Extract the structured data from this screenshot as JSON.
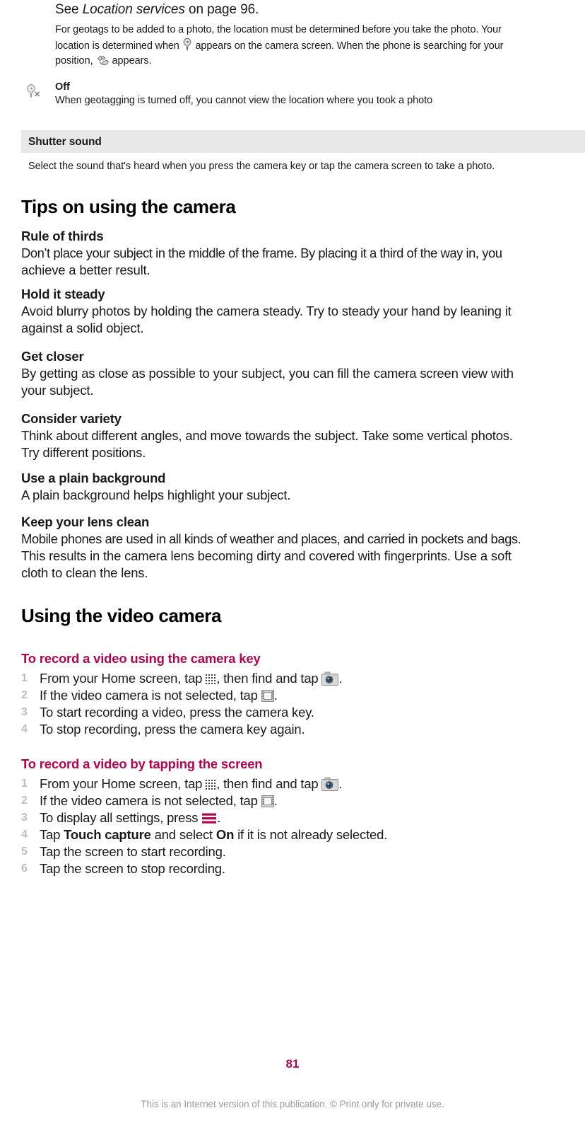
{
  "document": {
    "page_number": "81",
    "footnote": "This is an Internet version of this publication. © Print only for private use.",
    "accent_color": "#b3054f",
    "band_color": "#e8e8e8",
    "step_number_color": "#bdbdbd"
  },
  "intro": {
    "see_prefix": "See ",
    "see_link": "Location services",
    "see_suffix": " on page 96.",
    "geotag_paragraph": {
      "line1": "For geotags to be added to a photo, the location must be determined before you take the photo. Your",
      "line2_a": "location is determined when",
      "line2_icon": "location-pin-icon",
      "line2_b": "appears on the camera screen. When the phone is searching for your",
      "line3_a": "position,",
      "line3_icon": "satellite-searching-icon",
      "line3_b": "appears."
    }
  },
  "off_note": {
    "icon": "location-off-icon",
    "title": "Off",
    "body": "When geotagging is turned off, you cannot view the location where you took a photo"
  },
  "shutter_sound": {
    "label": "Shutter sound",
    "description": "Select the sound that's heard when you press the camera key or tap the camera screen to take a photo."
  },
  "tips_section": {
    "heading": "Tips on using the camera",
    "tips": [
      {
        "title": "Rule of thirds",
        "lines": [
          "Don’t place your subject in the middle of the frame. By placing it a third of the way in, you",
          "achieve a better result."
        ]
      },
      {
        "title": "Hold it steady",
        "lines": [
          "Avoid blurry photos by holding the camera steady. Try to steady your hand by leaning it",
          "against a solid object."
        ]
      },
      {
        "title": "Get closer",
        "lines": [
          "By getting as close as possible to your subject, you can fill the camera screen view with",
          "your subject."
        ]
      },
      {
        "title": "Consider variety",
        "lines": [
          "Think about different angles, and move towards the subject. Take some vertical photos.",
          "Try different positions."
        ]
      },
      {
        "title": "Use a plain background",
        "lines": [
          "A plain background helps highlight your subject."
        ]
      },
      {
        "title": "Keep your lens clean",
        "lines": [
          "Mobile phones are used in all kinds of weather and places, and carried in pockets and bags.",
          "This results in the camera lens becoming dirty and covered with fingerprints. Use a soft",
          "cloth to clean the lens."
        ]
      }
    ]
  },
  "video_section": {
    "heading": "Using the video camera",
    "procedures": [
      {
        "title": "To record a video using the camera key",
        "steps": [
          {
            "num": "1",
            "type": "icons_drawer_camera",
            "text_a": "From your Home screen, tap",
            "icon_a": "app-drawer-icon",
            "text_b": ", then find and tap",
            "icon_b": "camera-icon",
            "text_c": "."
          },
          {
            "num": "2",
            "type": "icon_film",
            "text_a": "If the video camera is not selected, tap",
            "icon_a": "video-camera-icon",
            "text_c": "."
          },
          {
            "num": "3",
            "type": "plain",
            "text_a": "To start recording a video, press the camera key."
          },
          {
            "num": "4",
            "type": "plain",
            "text_a": "To stop recording, press the camera key again."
          }
        ]
      },
      {
        "title": "To record a video by tapping the screen",
        "steps": [
          {
            "num": "1",
            "type": "icons_drawer_camera",
            "text_a": "From your Home screen, tap",
            "icon_a": "app-drawer-icon",
            "text_b": ", then find and tap",
            "icon_b": "camera-icon",
            "text_c": "."
          },
          {
            "num": "2",
            "type": "icon_film",
            "text_a": "If the video camera is not selected, tap",
            "icon_a": "video-camera-icon",
            "text_c": "."
          },
          {
            "num": "3",
            "type": "icon_menu",
            "text_a": "To display all settings, press",
            "icon_a": "menu-icon",
            "text_c": "."
          },
          {
            "num": "4",
            "type": "bold_terms",
            "text_a": "Tap ",
            "bold_a": "Touch capture",
            "text_b": " and select ",
            "bold_b": "On",
            "text_c": " if it is not already selected."
          },
          {
            "num": "5",
            "type": "plain",
            "text_a": "Tap the screen to start recording."
          },
          {
            "num": "6",
            "type": "plain",
            "text_a": "Tap the screen to stop recording."
          }
        ]
      }
    ]
  }
}
